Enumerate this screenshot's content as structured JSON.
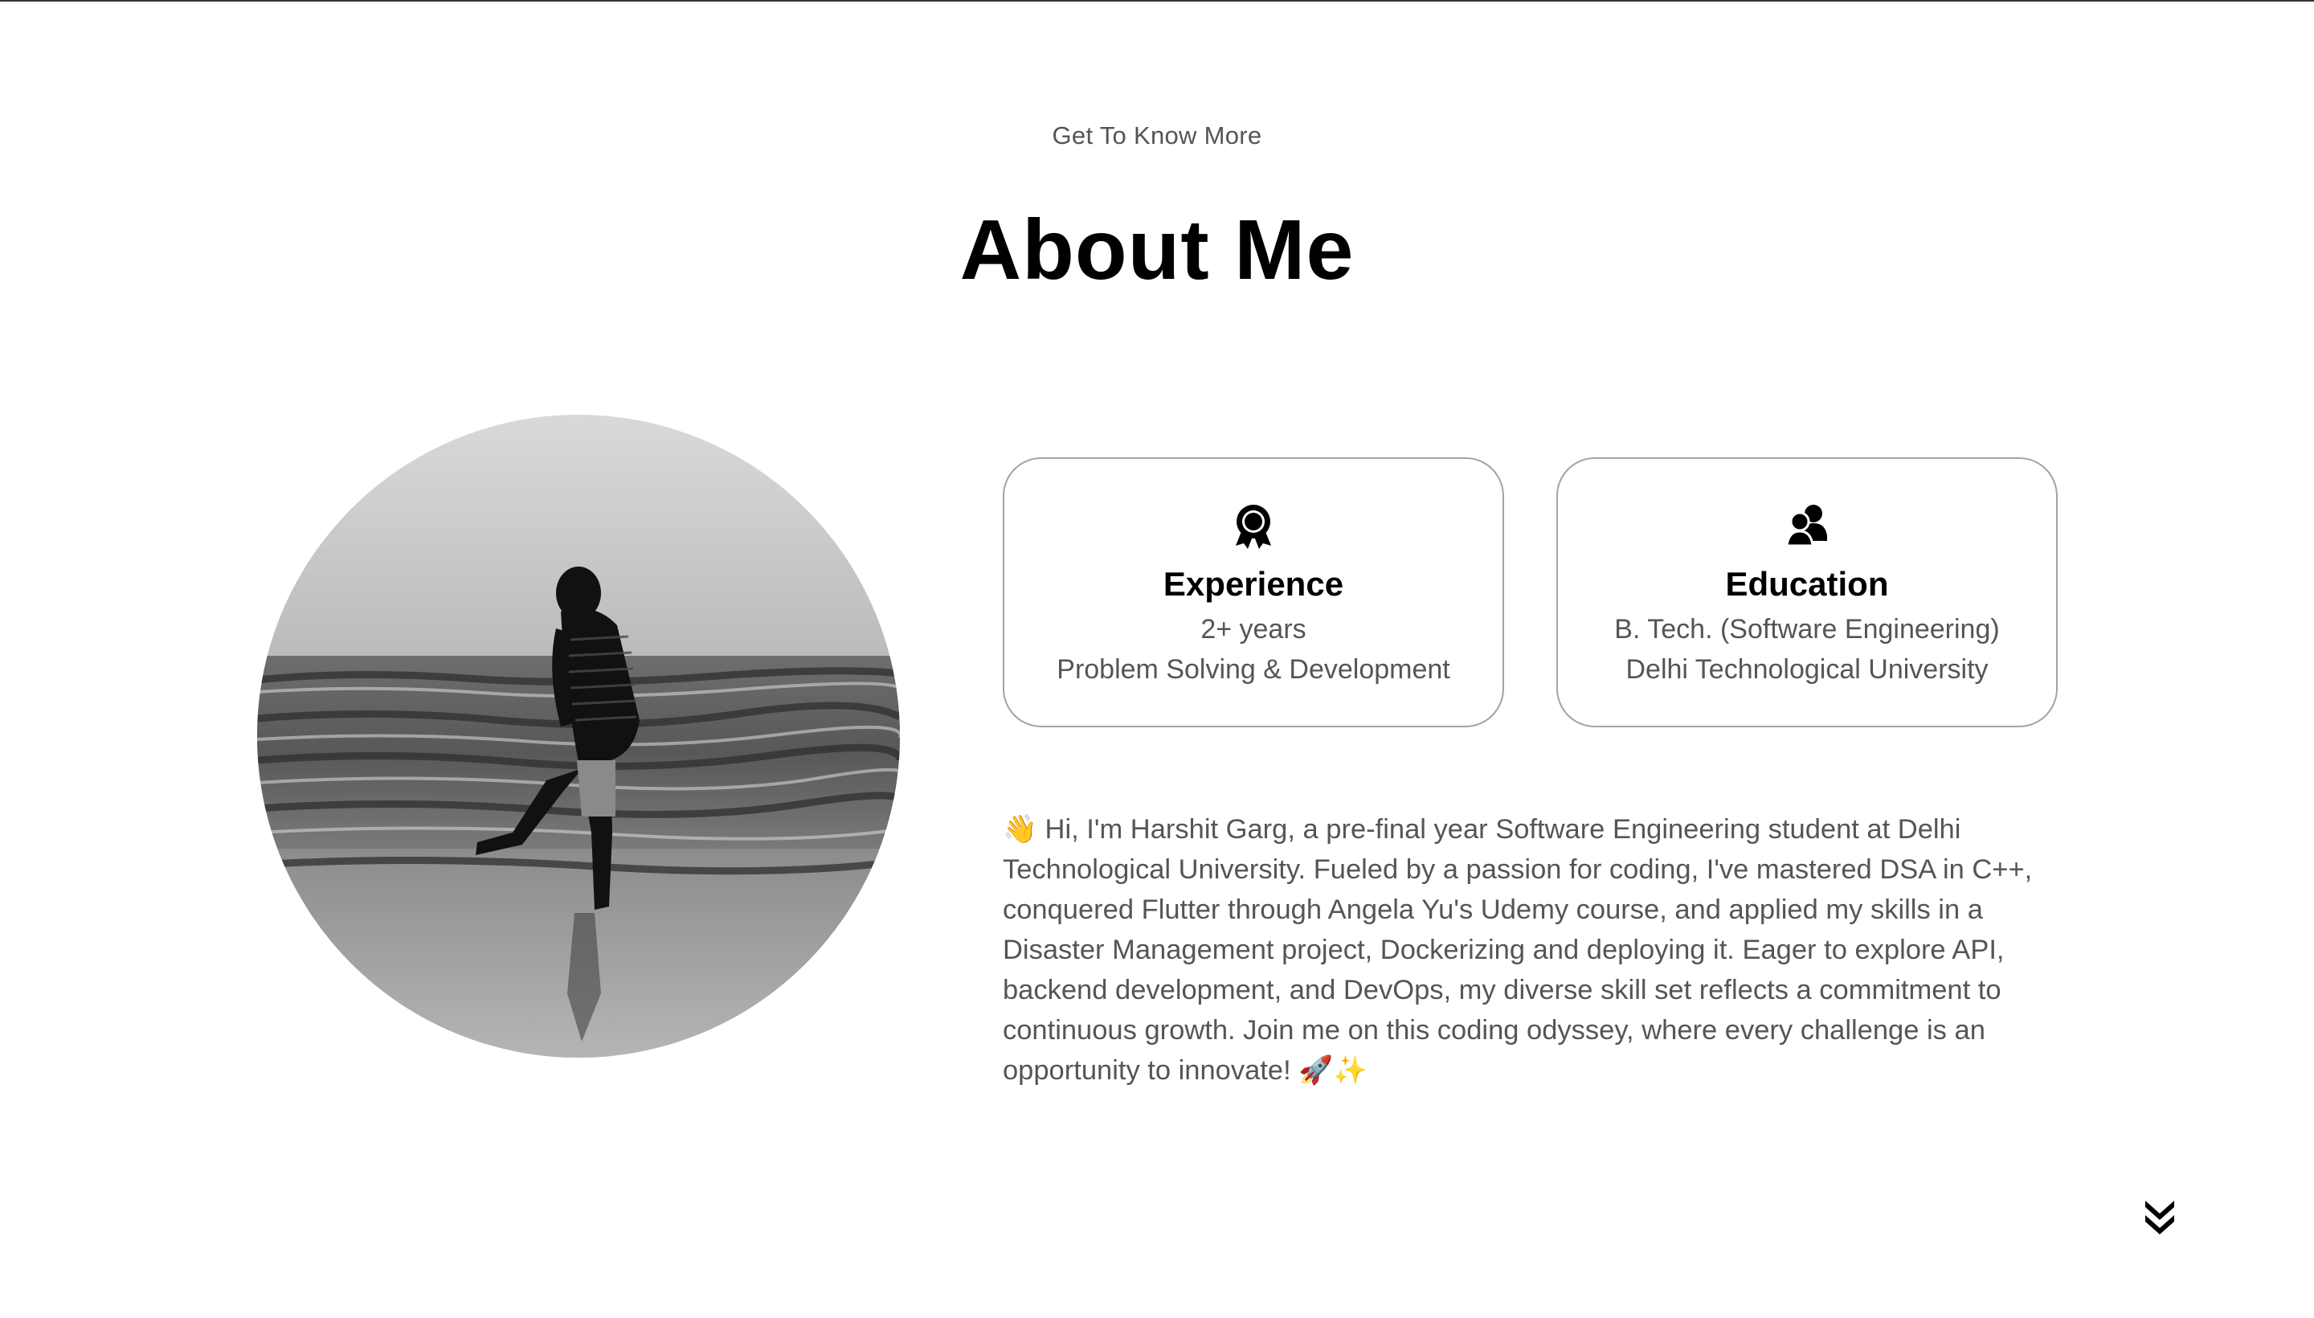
{
  "header": {
    "subtitle": "Get To Know More",
    "title": "About Me"
  },
  "photo": {
    "alt": "Harshit Garg kicking water at the beach, black and white"
  },
  "cards": [
    {
      "icon": "award-ribbon-icon",
      "title": "Experience",
      "line1": "2+ years",
      "line2": "Problem Solving & Development"
    },
    {
      "icon": "users-group-icon",
      "title": "Education",
      "line1": "B. Tech. (Software Engineering)",
      "line2": "Delhi Technological University"
    }
  ],
  "bio": {
    "text": "👋 Hi, I'm Harshit Garg, a pre-final year Software Engineering student at Delhi Technological University. Fueled by a passion for coding, I've mastered DSA in C++, conquered Flutter through Angela Yu's Udemy course, and applied my skills in a Disaster Management project, Dockerizing and deploying it. Eager to explore API, backend development, and DevOps, my diverse skill set reflects a commitment to continuous growth. Join me on this coding odyssey, where every challenge is an opportunity to innovate! 🚀✨"
  },
  "scroll": {
    "icon": "chevron-double-down-icon"
  },
  "colors": {
    "text_primary": "#000000",
    "text_secondary": "#555555",
    "card_border": "#a3a3a3",
    "background": "#ffffff"
  }
}
